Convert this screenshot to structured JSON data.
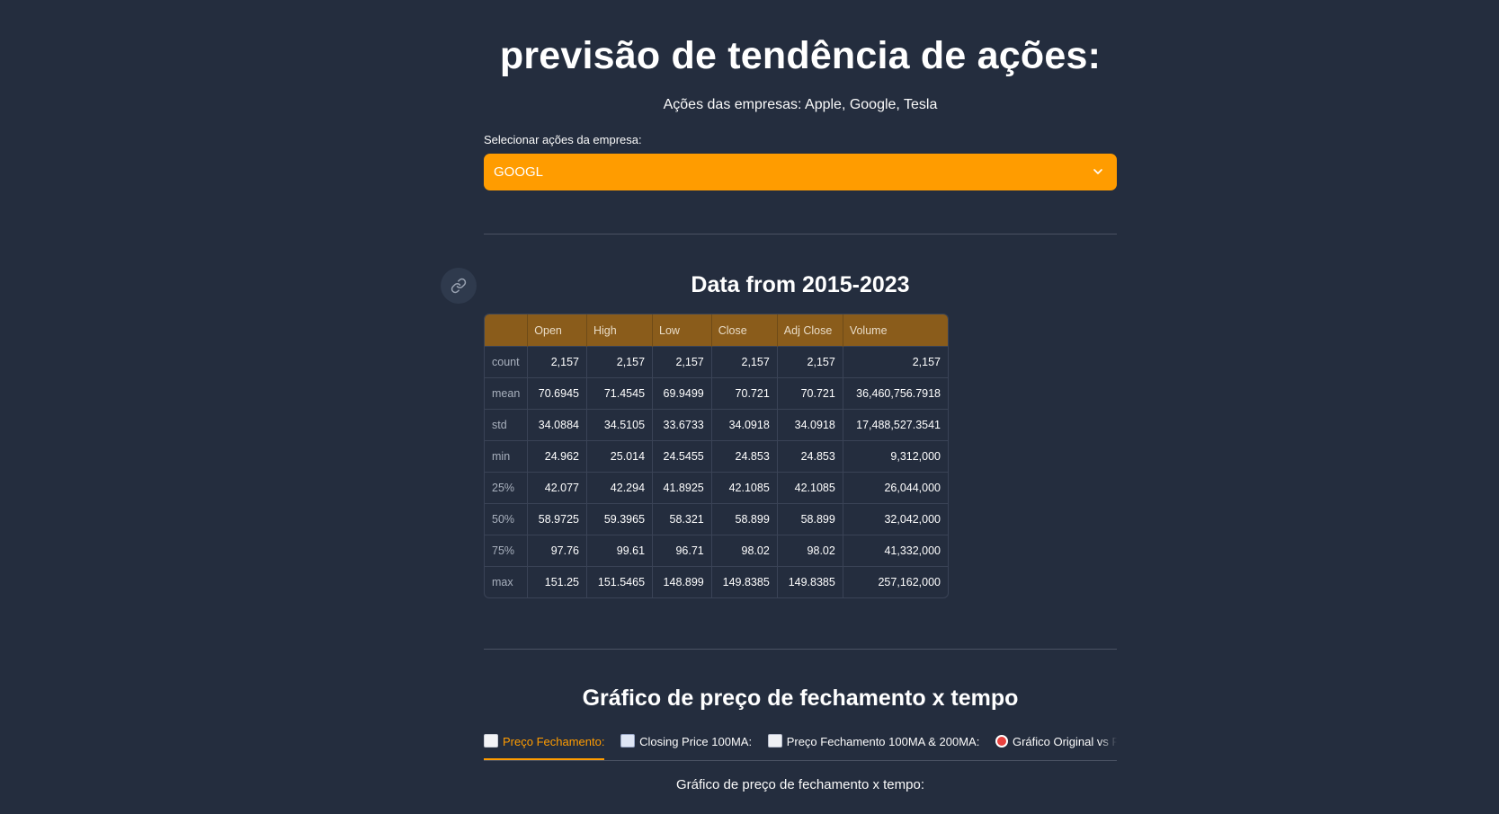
{
  "header": {
    "title": "previsão de tendência de ações:",
    "subtitle": "Ações das empresas: Apple, Google, Tesla"
  },
  "selector": {
    "label": "Selecionar ações da empresa:",
    "value": "GOOGL"
  },
  "stats": {
    "title": "Data from 2015-2023",
    "columns": [
      "",
      "Open",
      "High",
      "Low",
      "Close",
      "Adj Close",
      "Volume"
    ],
    "rows": [
      [
        "count",
        "2,157",
        "2,157",
        "2,157",
        "2,157",
        "2,157",
        "2,157"
      ],
      [
        "mean",
        "70.6945",
        "71.4545",
        "69.9499",
        "70.721",
        "70.721",
        "36,460,756.7918"
      ],
      [
        "std",
        "34.0884",
        "34.5105",
        "33.6733",
        "34.0918",
        "34.0918",
        "17,488,527.3541"
      ],
      [
        "min",
        "24.962",
        "25.014",
        "24.5455",
        "24.853",
        "24.853",
        "9,312,000"
      ],
      [
        "25%",
        "42.077",
        "42.294",
        "41.8925",
        "42.1085",
        "42.1085",
        "26,044,000"
      ],
      [
        "50%",
        "58.9725",
        "59.3965",
        "58.321",
        "58.899",
        "58.899",
        "32,042,000"
      ],
      [
        "75%",
        "97.76",
        "99.61",
        "96.71",
        "98.02",
        "98.02",
        "41,332,000"
      ],
      [
        "max",
        "151.25",
        "151.5465",
        "148.899",
        "149.8385",
        "149.8385",
        "257,162,000"
      ]
    ]
  },
  "chart_section": {
    "title": "Gráfico de preço de fechamento x tempo",
    "tabs": [
      {
        "icon": "chart-increasing-icon",
        "label": "Preço Fechamento:"
      },
      {
        "icon": "chart-decreasing-icon",
        "label": "Closing Price 100MA:"
      },
      {
        "icon": "bar-chart-icon",
        "label": "Preço Fechamento 100MA & 200MA:"
      },
      {
        "icon": "target-icon",
        "label": "Gráfico Original vs Pre"
      }
    ],
    "active_tab": 0,
    "caption": "Gráfico de preço de fechamento x tempo:"
  },
  "colors": {
    "background": "#242d3e",
    "accent": "#ff9c00",
    "table_header": "#8a5c1b"
  }
}
